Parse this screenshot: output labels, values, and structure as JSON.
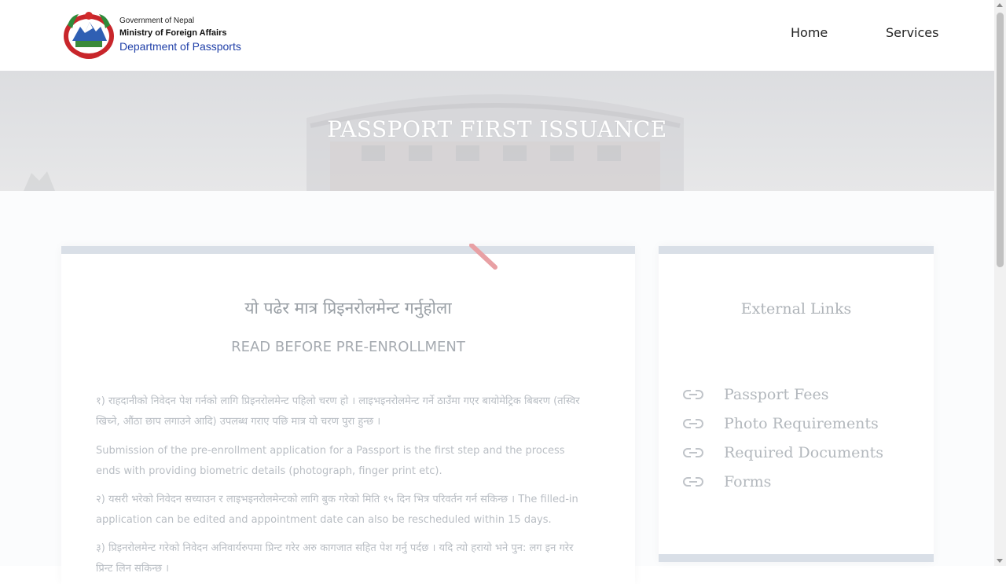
{
  "header": {
    "logo_line1": "Government of Nepal",
    "logo_line2": "Ministry of Foreign Affairs",
    "logo_line3": "Department of Passports",
    "nav": [
      {
        "label": "Home"
      },
      {
        "label": "Services"
      }
    ]
  },
  "hero": {
    "title": "PASSPORT FIRST ISSUANCE"
  },
  "main": {
    "nepali_title": "यो पढेर मात्र प्रिइनरोलमेन्ट गर्नुहोला",
    "english_title": "READ BEFORE PRE-ENROLLMENT",
    "paragraphs": [
      "१) राहदानीको निवेदन पेश गर्नको लागि प्रिइनरोलमेन्ट पहिलो चरण हो । लाइभइनरोलमेन्ट गर्ने ठाउँमा गएर बायोमेट्रिक बिबरण (तस्विर खिच्ने, औंठा छाप लगाउने आदि) उपलब्ध गराए पछि मात्र यो चरण पुरा हुन्छ ।",
      "Submission of the pre-enrollment application for a Passport is the first step and the process ends with providing biometric details (photograph, finger print etc).",
      "२) यसरी भरेको निवेदन सच्याउन र लाइभइनरोलमेन्टको लागि बुक गरेको मिति १५ दिन भित्र परिवर्तन गर्न सकिन्छ । The filled-in application can be edited and appointment date can also be rescheduled within 15 days.",
      "३) प्रिइनरोलमेन्ट गरेको निवेदन अनिवार्यरुपमा प्रिन्ट गरेर अरु कागजात सहित पेश गर्नु पर्दछ । यदि त्यो हरायो भने पुन: लग इन गरेर प्रिन्ट लिन सकिन्छ ।"
    ]
  },
  "sidebar": {
    "title": "External Links",
    "links": [
      {
        "label": "Passport Fees",
        "icon": "link-icon"
      },
      {
        "label": "Photo Requirements",
        "icon": "link-icon"
      },
      {
        "label": "Required Documents",
        "icon": "link-icon"
      },
      {
        "label": "Forms",
        "icon": "link-icon"
      }
    ]
  },
  "colors": {
    "accent_blue": "#1f3fa8",
    "card_border": "#d9dfe7",
    "spinner": "#e8a0a4"
  }
}
